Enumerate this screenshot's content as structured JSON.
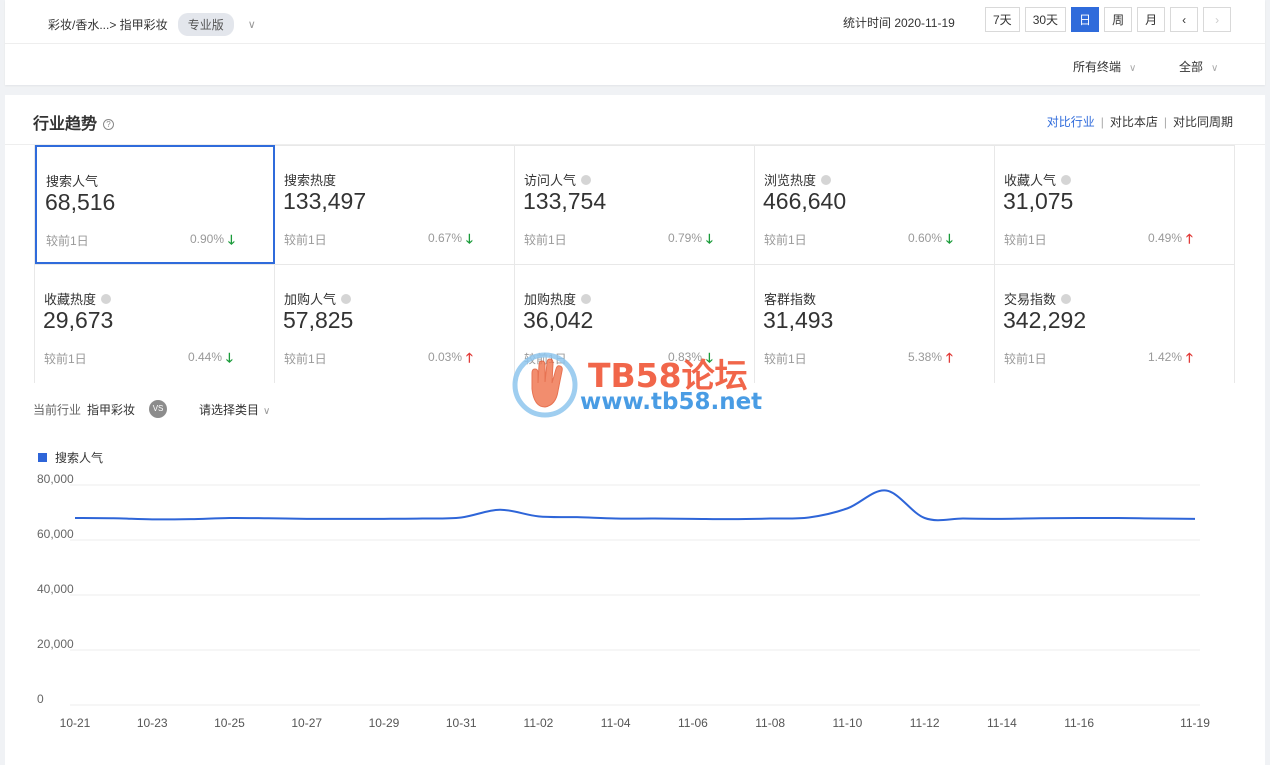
{
  "top": {
    "breadcrumb": "彩妆/香水...> 指甲彩妆",
    "edition": "专业版",
    "stat_time": "统计时间 2020-11-19",
    "periods": [
      "7天",
      "30天",
      "日",
      "周",
      "月"
    ],
    "active_period": "日",
    "terminal": "所有终端",
    "scope": "全部"
  },
  "section": {
    "title": "行业趋势",
    "compare": [
      "对比行业",
      "对比本店",
      "对比同周期"
    ],
    "active_compare": "对比行业"
  },
  "metrics": [
    {
      "name": "搜索人气",
      "value": "68,516",
      "cmp_label": "较前1日",
      "pct": "0.90%",
      "dir": "down",
      "dot": false,
      "selected": true
    },
    {
      "name": "搜索热度",
      "value": "133,497",
      "cmp_label": "较前1日",
      "pct": "0.67%",
      "dir": "down",
      "dot": false
    },
    {
      "name": "访问人气",
      "value": "133,754",
      "cmp_label": "较前1日",
      "pct": "0.79%",
      "dir": "down",
      "dot": true
    },
    {
      "name": "浏览热度",
      "value": "466,640",
      "cmp_label": "较前1日",
      "pct": "0.60%",
      "dir": "down",
      "dot": true
    },
    {
      "name": "收藏人气",
      "value": "31,075",
      "cmp_label": "较前1日",
      "pct": "0.49%",
      "dir": "up",
      "dot": true
    },
    {
      "name": "收藏热度",
      "value": "29,673",
      "cmp_label": "较前1日",
      "pct": "0.44%",
      "dir": "down",
      "dot": true
    },
    {
      "name": "加购人气",
      "value": "57,825",
      "cmp_label": "较前1日",
      "pct": "0.03%",
      "dir": "up",
      "dot": true
    },
    {
      "name": "加购热度",
      "value": "36,042",
      "cmp_label": "较前1日",
      "pct": "0.83%",
      "dir": "down",
      "dot": true
    },
    {
      "name": "客群指数",
      "value": "31,493",
      "cmp_label": "较前1日",
      "pct": "5.38%",
      "dir": "up",
      "dot": false
    },
    {
      "name": "交易指数",
      "value": "342,292",
      "cmp_label": "较前1日",
      "pct": "1.42%",
      "dir": "up",
      "dot": true
    }
  ],
  "filter": {
    "current_label": "当前行业",
    "current_value": "指甲彩妆",
    "vs": "VS",
    "pick": "请选择类目"
  },
  "watermark": {
    "line1": "TB58论坛",
    "line2": "www.tb58.net"
  },
  "colors": {
    "accent": "#2f6bdb",
    "line": "#2e65d8",
    "up": "#e13c39",
    "down": "#1a9b3a"
  },
  "chart_data": {
    "type": "line",
    "x_tick_labels": [
      "10-21",
      "10-23",
      "10-25",
      "10-27",
      "10-29",
      "10-31",
      "11-02",
      "11-04",
      "11-06",
      "11-08",
      "11-10",
      "11-12",
      "11-14",
      "11-16",
      "11-19"
    ],
    "y_tick_labels": [
      "80,000",
      "60,000",
      "40,000",
      "20,000",
      "0"
    ],
    "ylim": [
      0,
      80000
    ],
    "legend": "top-left",
    "series": [
      {
        "name": "搜索人气",
        "x": [
          "10-21",
          "10-22",
          "10-23",
          "10-24",
          "10-25",
          "10-26",
          "10-27",
          "10-28",
          "10-29",
          "10-30",
          "10-31",
          "11-01",
          "11-02",
          "11-03",
          "11-04",
          "11-05",
          "11-06",
          "11-07",
          "11-08",
          "11-09",
          "11-10",
          "11-11",
          "11-12",
          "11-13",
          "11-14",
          "11-15",
          "11-16",
          "11-17",
          "11-18",
          "11-19"
        ],
        "values": [
          68000,
          67900,
          67500,
          67600,
          68000,
          67900,
          67700,
          67700,
          67700,
          67800,
          68200,
          71000,
          68600,
          68300,
          67800,
          67800,
          67700,
          67600,
          67800,
          68200,
          71500,
          78000,
          68000,
          67800,
          67700,
          67900,
          68000,
          68000,
          67800,
          67700
        ]
      }
    ]
  }
}
